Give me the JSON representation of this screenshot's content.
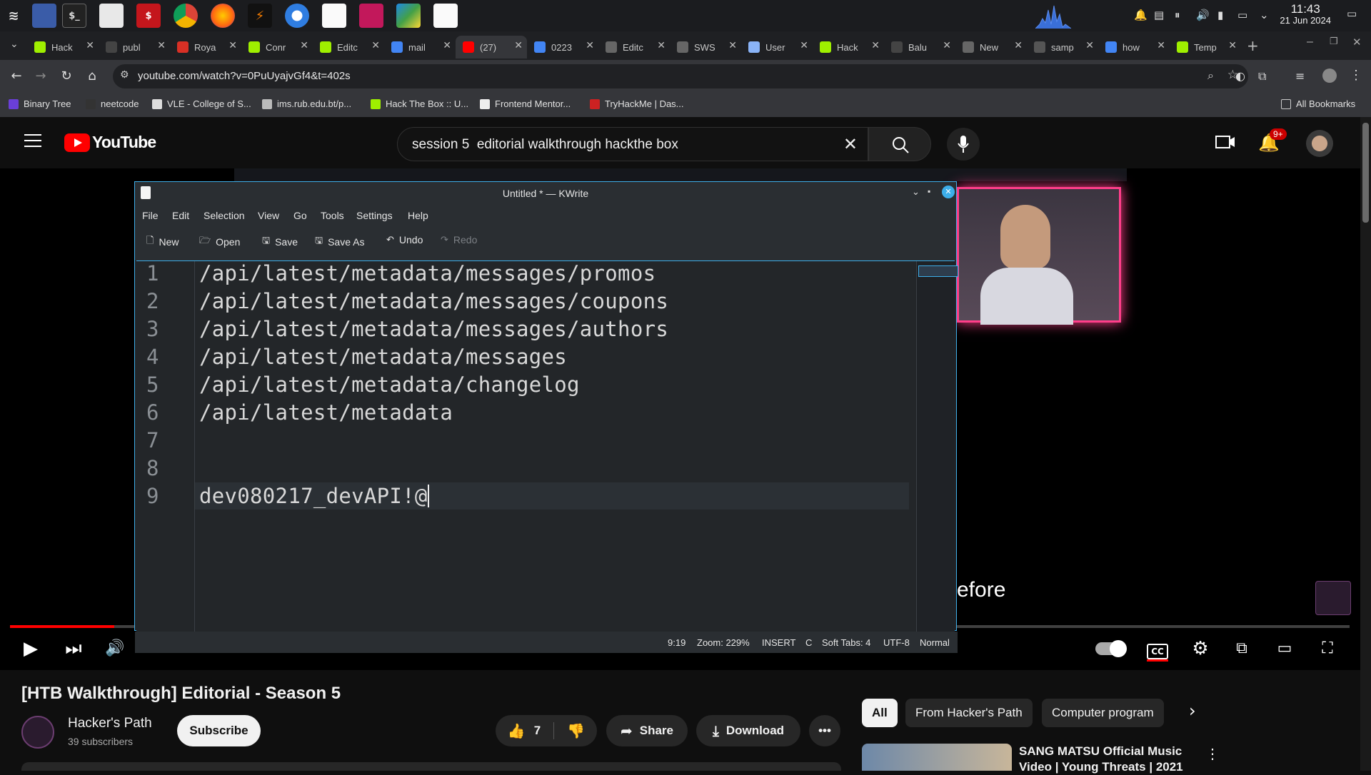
{
  "os": {
    "clock_time": "11:43",
    "clock_date": "21 Jun 2024"
  },
  "browser": {
    "tabs": [
      {
        "label": "Hack",
        "favicon": "htb-icon"
      },
      {
        "label": "publ",
        "favicon": "github-icon"
      },
      {
        "label": "Roya",
        "favicon": "gmail-icon"
      },
      {
        "label": "Conr",
        "favicon": "htb-icon"
      },
      {
        "label": "Editc",
        "favicon": "htb-icon"
      },
      {
        "label": "mail",
        "favicon": "google-icon"
      },
      {
        "label": "(27)",
        "favicon": "youtube-icon"
      },
      {
        "label": "0223",
        "favicon": "docs-icon"
      },
      {
        "label": "Editc",
        "favicon": "globe-icon"
      },
      {
        "label": "SWS",
        "favicon": "globe-icon"
      },
      {
        "label": "User",
        "favicon": "page-icon"
      },
      {
        "label": "Hack",
        "favicon": "htb-icon"
      },
      {
        "label": "Balu",
        "favicon": "github-icon"
      },
      {
        "label": "New",
        "favicon": "globe-icon"
      },
      {
        "label": "samp",
        "favicon": "code-icon"
      },
      {
        "label": "how",
        "favicon": "google-icon"
      },
      {
        "label": "Temp",
        "favicon": "htb-icon"
      }
    ],
    "active_tab_index": 6,
    "url": "youtube.com/watch?v=0PuUyajvGf4&t=402s",
    "bookmarks": [
      "Binary Tree",
      "neetcode",
      "VLE - College of S...",
      "ims.rub.edu.bt/p...",
      "Hack The Box :: U...",
      "Frontend Mentor...",
      "TryHackMe | Das..."
    ],
    "all_bookmarks": "All Bookmarks"
  },
  "youtube": {
    "logo_text": "YouTube",
    "search_query": "session 5  editorial walkthrough hackthe box",
    "notification_count": "9+",
    "caption_text": "efore",
    "progress": 0.078,
    "video_title": "[HTB Walkthrough] Editorial - Season 5",
    "channel_name": "Hacker's Path",
    "subscribers": "39 subscribers",
    "subscribe_label": "Subscribe",
    "likes": "7",
    "share_label": "Share",
    "download_label": "Download",
    "chips": [
      "All",
      "From Hacker's Path",
      "Computer program"
    ],
    "rec_title": "SANG MATSU Official Music Video | Young Threats | 2021"
  },
  "kwrite": {
    "title": "Untitled * — KWrite",
    "menu": [
      "File",
      "Edit",
      "Selection",
      "View",
      "Go",
      "Tools",
      "Settings",
      "Help"
    ],
    "toolbar": {
      "new": "New",
      "open": "Open",
      "save": "Save",
      "save_as": "Save As",
      "undo": "Undo",
      "redo": "Redo"
    },
    "lines": [
      "/api/latest/metadata/messages/promos",
      "/api/latest/metadata/messages/coupons",
      "/api/latest/metadata/messages/authors",
      "/api/latest/metadata/messages",
      "/api/latest/metadata/changelog",
      "/api/latest/metadata",
      "",
      "",
      "dev080217_devAPI!@"
    ],
    "line_numbers": [
      "1",
      "2",
      "3",
      "4",
      "5",
      "6",
      "7",
      "8",
      "9"
    ],
    "status": {
      "position": "9:19",
      "zoom": "Zoom: 229%",
      "mode": "INSERT",
      "c": "C",
      "tabs": "Soft Tabs: 4",
      "encoding": "UTF-8",
      "input_mode": "Normal"
    }
  }
}
